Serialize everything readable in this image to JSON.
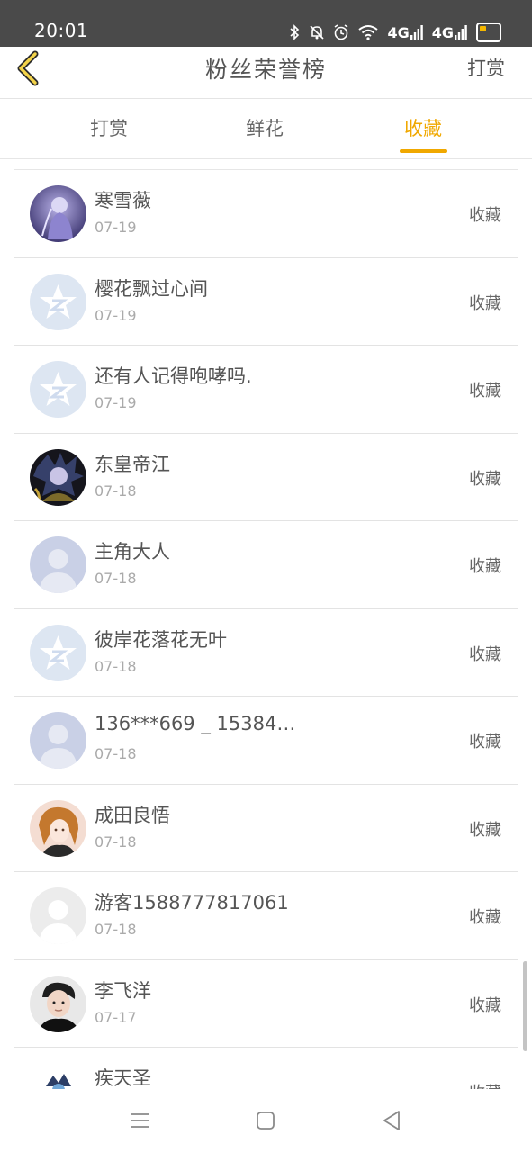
{
  "status_bar": {
    "time": "20:01",
    "icons": [
      "bluetooth-icon",
      "mute-icon",
      "alarm-icon",
      "wifi-icon",
      "signal-4g-icon",
      "signal-4g-icon",
      "battery-icon"
    ],
    "signal_label_1": "4G",
    "signal_label_2": "4G",
    "battery_color": "#f5b800"
  },
  "header": {
    "title": "粉丝荣誉榜",
    "action_label": "打赏",
    "accent_color": "#f0a800"
  },
  "tabs": [
    {
      "label": "打赏",
      "active": false
    },
    {
      "label": "鲜花",
      "active": false
    },
    {
      "label": "收藏",
      "active": true
    }
  ],
  "fans": [
    {
      "name": "寒雪薇",
      "date": "07-19",
      "action": "收藏",
      "avatar": "anime-girl-avatar"
    },
    {
      "name": "樱花飘过心间",
      "date": "07-19",
      "action": "收藏",
      "avatar": "default-star-avatar"
    },
    {
      "name": "还有人记得咆哮吗.",
      "date": "07-19",
      "action": "收藏",
      "avatar": "default-star-avatar"
    },
    {
      "name": "东皇帝江",
      "date": "07-18",
      "action": "收藏",
      "avatar": "dark-anime-avatar"
    },
    {
      "name": "主角大人",
      "date": "07-18",
      "action": "收藏",
      "avatar": "default-person-avatar"
    },
    {
      "name": "彼岸花落花无叶",
      "date": "07-18",
      "action": "收藏",
      "avatar": "default-star-avatar"
    },
    {
      "name": "136***669 _ 15384…",
      "date": "07-18",
      "action": "收藏",
      "avatar": "default-person-avatar"
    },
    {
      "name": "成田良悟",
      "date": "07-18",
      "action": "收藏",
      "avatar": "anime-girl-avatar"
    },
    {
      "name": "游客1588777817061",
      "date": "07-18",
      "action": "收藏",
      "avatar": "default-grey-avatar"
    },
    {
      "name": "李飞洋",
      "date": "07-17",
      "action": "收藏",
      "avatar": "photo-avatar"
    },
    {
      "name": "疾天圣",
      "date": "",
      "action": "收藏",
      "avatar": "dark-anime-avatar"
    }
  ],
  "bottom_nav": [
    "menu-icon",
    "home-icon",
    "back-icon"
  ]
}
